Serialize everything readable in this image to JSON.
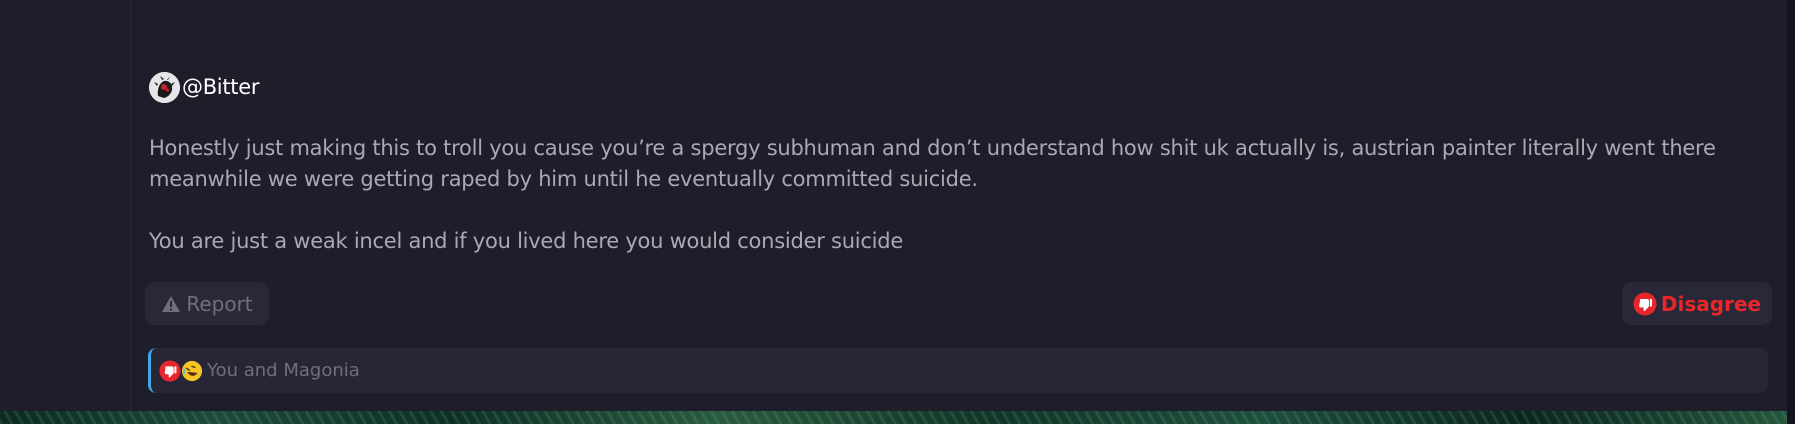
{
  "post": {
    "author": "@Bitter",
    "paragraphs": [
      "Honestly just making this to troll you cause you’re a spergy subhuman and don’t understand how shit uk actually is, austrian painter literally went there meanwhile we were getting raped by him until he eventually committed suicide.",
      "You are just a weak incel and if you lived here you would consider suicide"
    ]
  },
  "actions": {
    "report_label": "Report",
    "disagree_label": "Disagree"
  },
  "reactions": {
    "summary": "You and Magonia",
    "icons": [
      "thumbs-down-reaction-icon",
      "laughing-reaction-icon"
    ]
  },
  "colors": {
    "background": "#1e1d2a",
    "text": "#a9a8b4",
    "disagree": "#e8262b",
    "accent": "#3fa8e6"
  }
}
